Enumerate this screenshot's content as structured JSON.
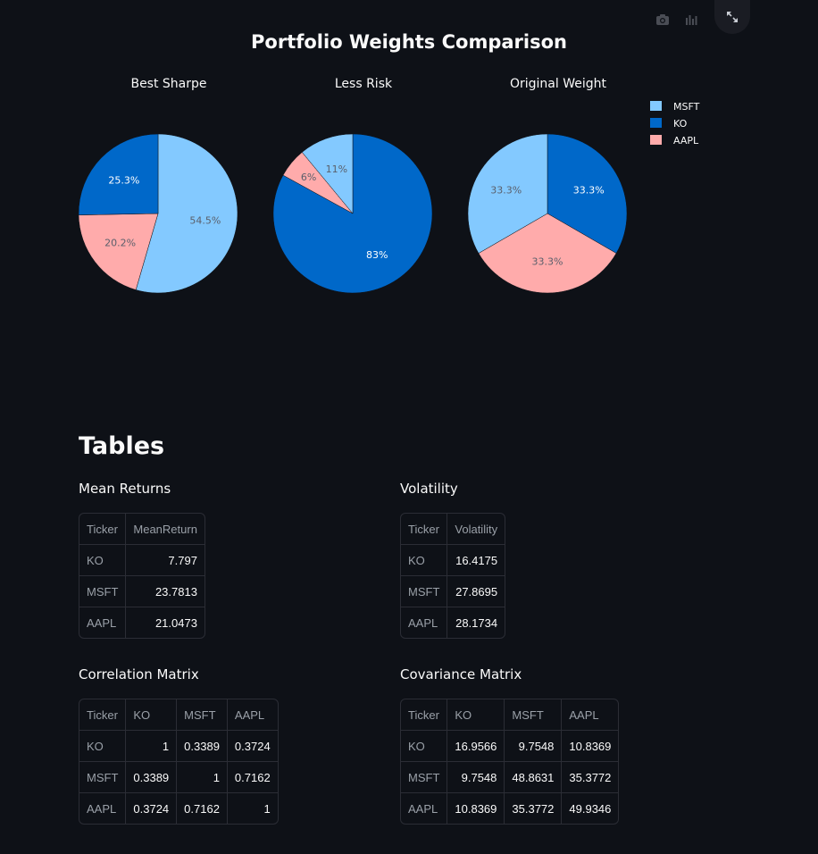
{
  "chart_data": {
    "type": "pie",
    "title": "Portfolio Weights Comparison",
    "legend": {
      "placement": "top-right",
      "entries": [
        "MSFT",
        "KO",
        "AAPL"
      ],
      "colors": [
        "#83c9ff",
        "#0068c9",
        "#ffabab"
      ]
    },
    "pies": [
      {
        "subtitle": "Best Sharpe",
        "slices": [
          {
            "label": "MSFT",
            "value": 54.5,
            "text": "54.5%"
          },
          {
            "label": "AAPL",
            "value": 20.2,
            "text": "20.2%"
          },
          {
            "label": "KO",
            "value": 25.3,
            "text": "25.3%"
          }
        ]
      },
      {
        "subtitle": "Less Risk",
        "slices": [
          {
            "label": "KO",
            "value": 83,
            "text": "83%"
          },
          {
            "label": "AAPL",
            "value": 6,
            "text": "6%"
          },
          {
            "label": "MSFT",
            "value": 11,
            "text": "11%"
          }
        ]
      },
      {
        "subtitle": "Original Weight",
        "slices": [
          {
            "label": "KO",
            "value": 33.33,
            "text": "33.3%"
          },
          {
            "label": "AAPL",
            "value": 33.33,
            "text": "33.3%"
          },
          {
            "label": "MSFT",
            "value": 33.34,
            "text": "33.3%"
          }
        ]
      }
    ]
  },
  "toolbar": {
    "camera_icon": "camera-icon",
    "bars_icon": "bar-chart-icon",
    "expand_icon": "fullscreen-icon"
  },
  "tables_heading": "Tables",
  "tables": {
    "mean_returns": {
      "title": "Mean Returns",
      "headers": [
        "Ticker",
        "MeanReturn"
      ],
      "rows": [
        [
          "KO",
          "7.797"
        ],
        [
          "MSFT",
          "23.7813"
        ],
        [
          "AAPL",
          "21.0473"
        ]
      ]
    },
    "volatility": {
      "title": "Volatility",
      "headers": [
        "Ticker",
        "Volatility"
      ],
      "rows": [
        [
          "KO",
          "16.4175"
        ],
        [
          "MSFT",
          "27.8695"
        ],
        [
          "AAPL",
          "28.1734"
        ]
      ]
    },
    "correlation": {
      "title": "Correlation Matrix",
      "headers": [
        "Ticker",
        "KO",
        "MSFT",
        "AAPL"
      ],
      "rows": [
        [
          "KO",
          "1",
          "0.3389",
          "0.3724"
        ],
        [
          "MSFT",
          "0.3389",
          "1",
          "0.7162"
        ],
        [
          "AAPL",
          "0.3724",
          "0.7162",
          "1"
        ]
      ]
    },
    "covariance": {
      "title": "Covariance Matrix",
      "headers": [
        "Ticker",
        "KO",
        "MSFT",
        "AAPL"
      ],
      "rows": [
        [
          "KO",
          "16.9566",
          "9.7548",
          "10.8369"
        ],
        [
          "MSFT",
          "9.7548",
          "48.8631",
          "35.3772"
        ],
        [
          "AAPL",
          "10.8369",
          "35.3772",
          "49.9346"
        ]
      ]
    }
  },
  "colors": {
    "background": "#0e1117",
    "MSFT": "#83c9ff",
    "KO": "#0068c9",
    "AAPL": "#ffabab"
  }
}
